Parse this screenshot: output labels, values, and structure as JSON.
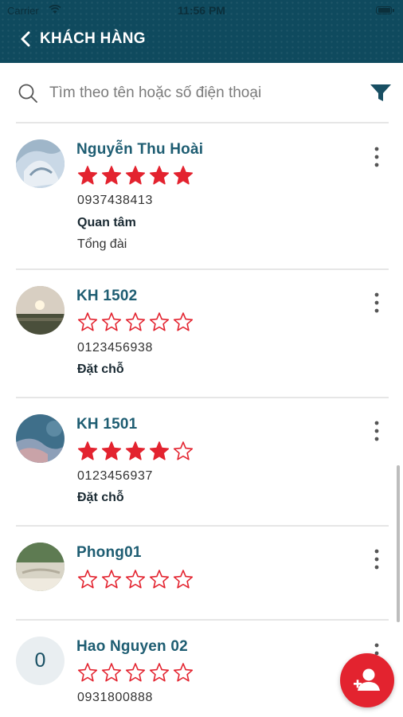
{
  "status_bar": {
    "carrier": "Carrier",
    "time": "11:56 PM"
  },
  "header": {
    "title": "KHÁCH HÀNG",
    "back_icon": "chevron-left-icon"
  },
  "search": {
    "placeholder": "Tìm theo tên hoặc số điện thoại",
    "filter_icon": "filter-icon"
  },
  "colors": {
    "header": "#0f4a5e",
    "name": "#1e5d72",
    "star": "#e3232f",
    "fab": "#e3232f"
  },
  "customers": [
    {
      "name": "Nguyễn Thu Hoài",
      "rating": 5,
      "phone": "0937438413",
      "status": "Quan tâm",
      "source": "Tổng đài",
      "avatar": "photo"
    },
    {
      "name": "KH 1502",
      "rating": 0,
      "phone": "0123456938",
      "status": "Đặt chỗ",
      "avatar": "photo"
    },
    {
      "name": "KH 1501",
      "rating": 4,
      "phone": "0123456937",
      "status": "Đặt chỗ",
      "avatar": "photo"
    },
    {
      "name": "Phong01",
      "rating": 0,
      "avatar": "photo"
    },
    {
      "name": "Hao Nguyen 02",
      "rating": 0,
      "phone": "0931800888",
      "avatar_letter": "0"
    }
  ],
  "fab": {
    "icon": "add-user-icon"
  }
}
